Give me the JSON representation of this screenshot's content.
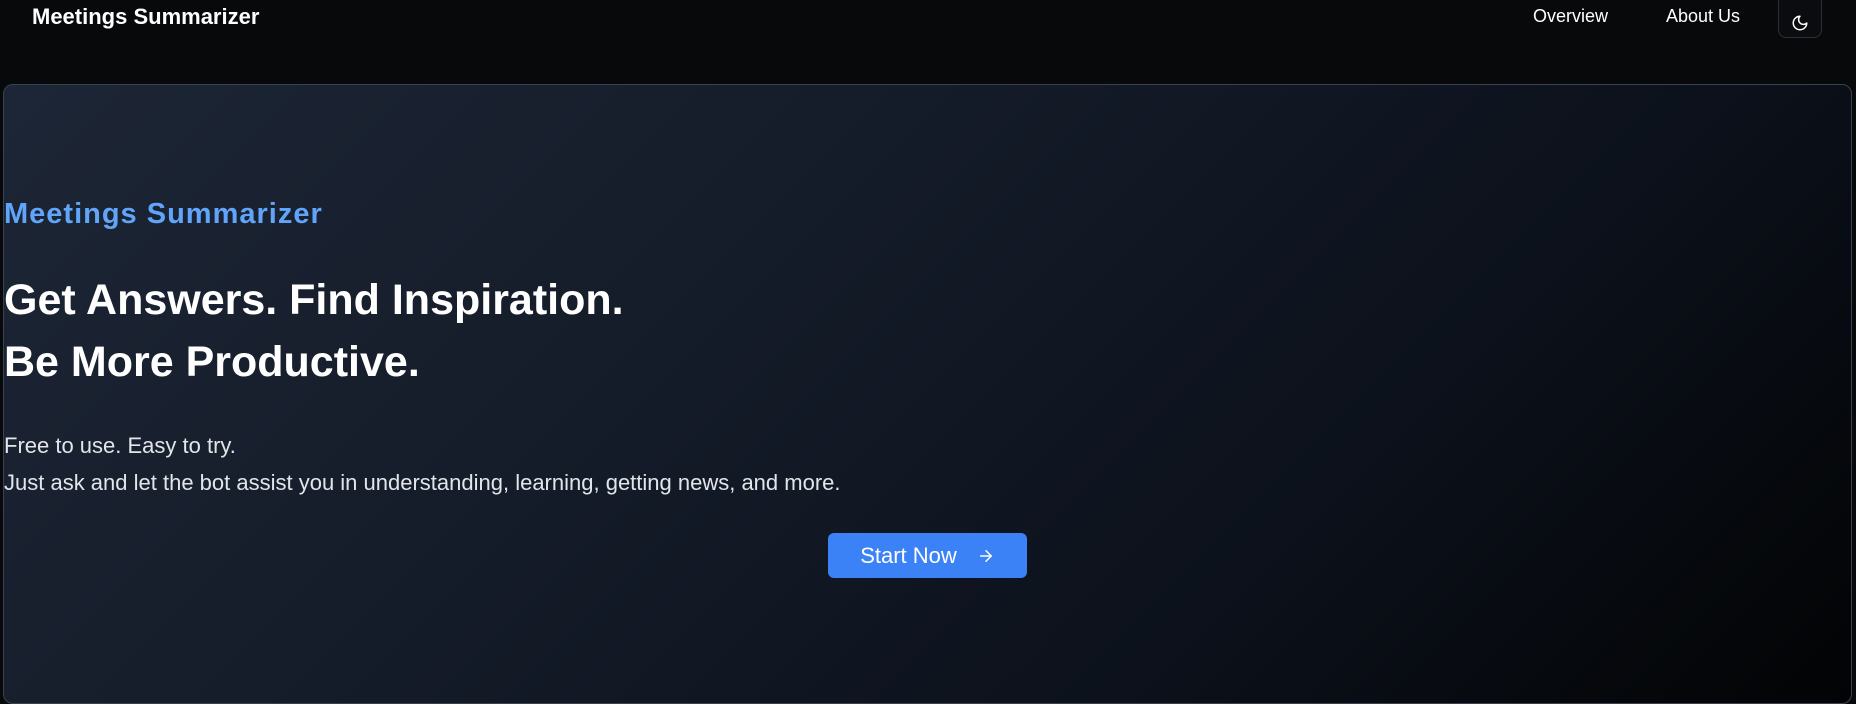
{
  "header": {
    "brand": "Meetings Summarizer",
    "nav": [
      {
        "label": "Overview"
      },
      {
        "label": "About Us"
      }
    ],
    "theme_toggle_icon": "moon-icon"
  },
  "hero": {
    "eyebrow": "Meetings Summarizer",
    "headline_line1": "Get Answers. Find Inspiration.",
    "headline_line2": "Be More Productive.",
    "sub_line1": "Free to use. Easy to try.",
    "sub_line2": "Just ask and let the bot assist you in understanding, learning, getting news, and more.",
    "cta_label": "Start Now",
    "cta_icon": "arrow-right-icon"
  },
  "colors": {
    "accent": "#3b82f6",
    "eyebrow": "#60a5fa",
    "background": "#08090b",
    "hero_gradient_start": "#1d2636",
    "hero_gradient_end": "#020304"
  }
}
